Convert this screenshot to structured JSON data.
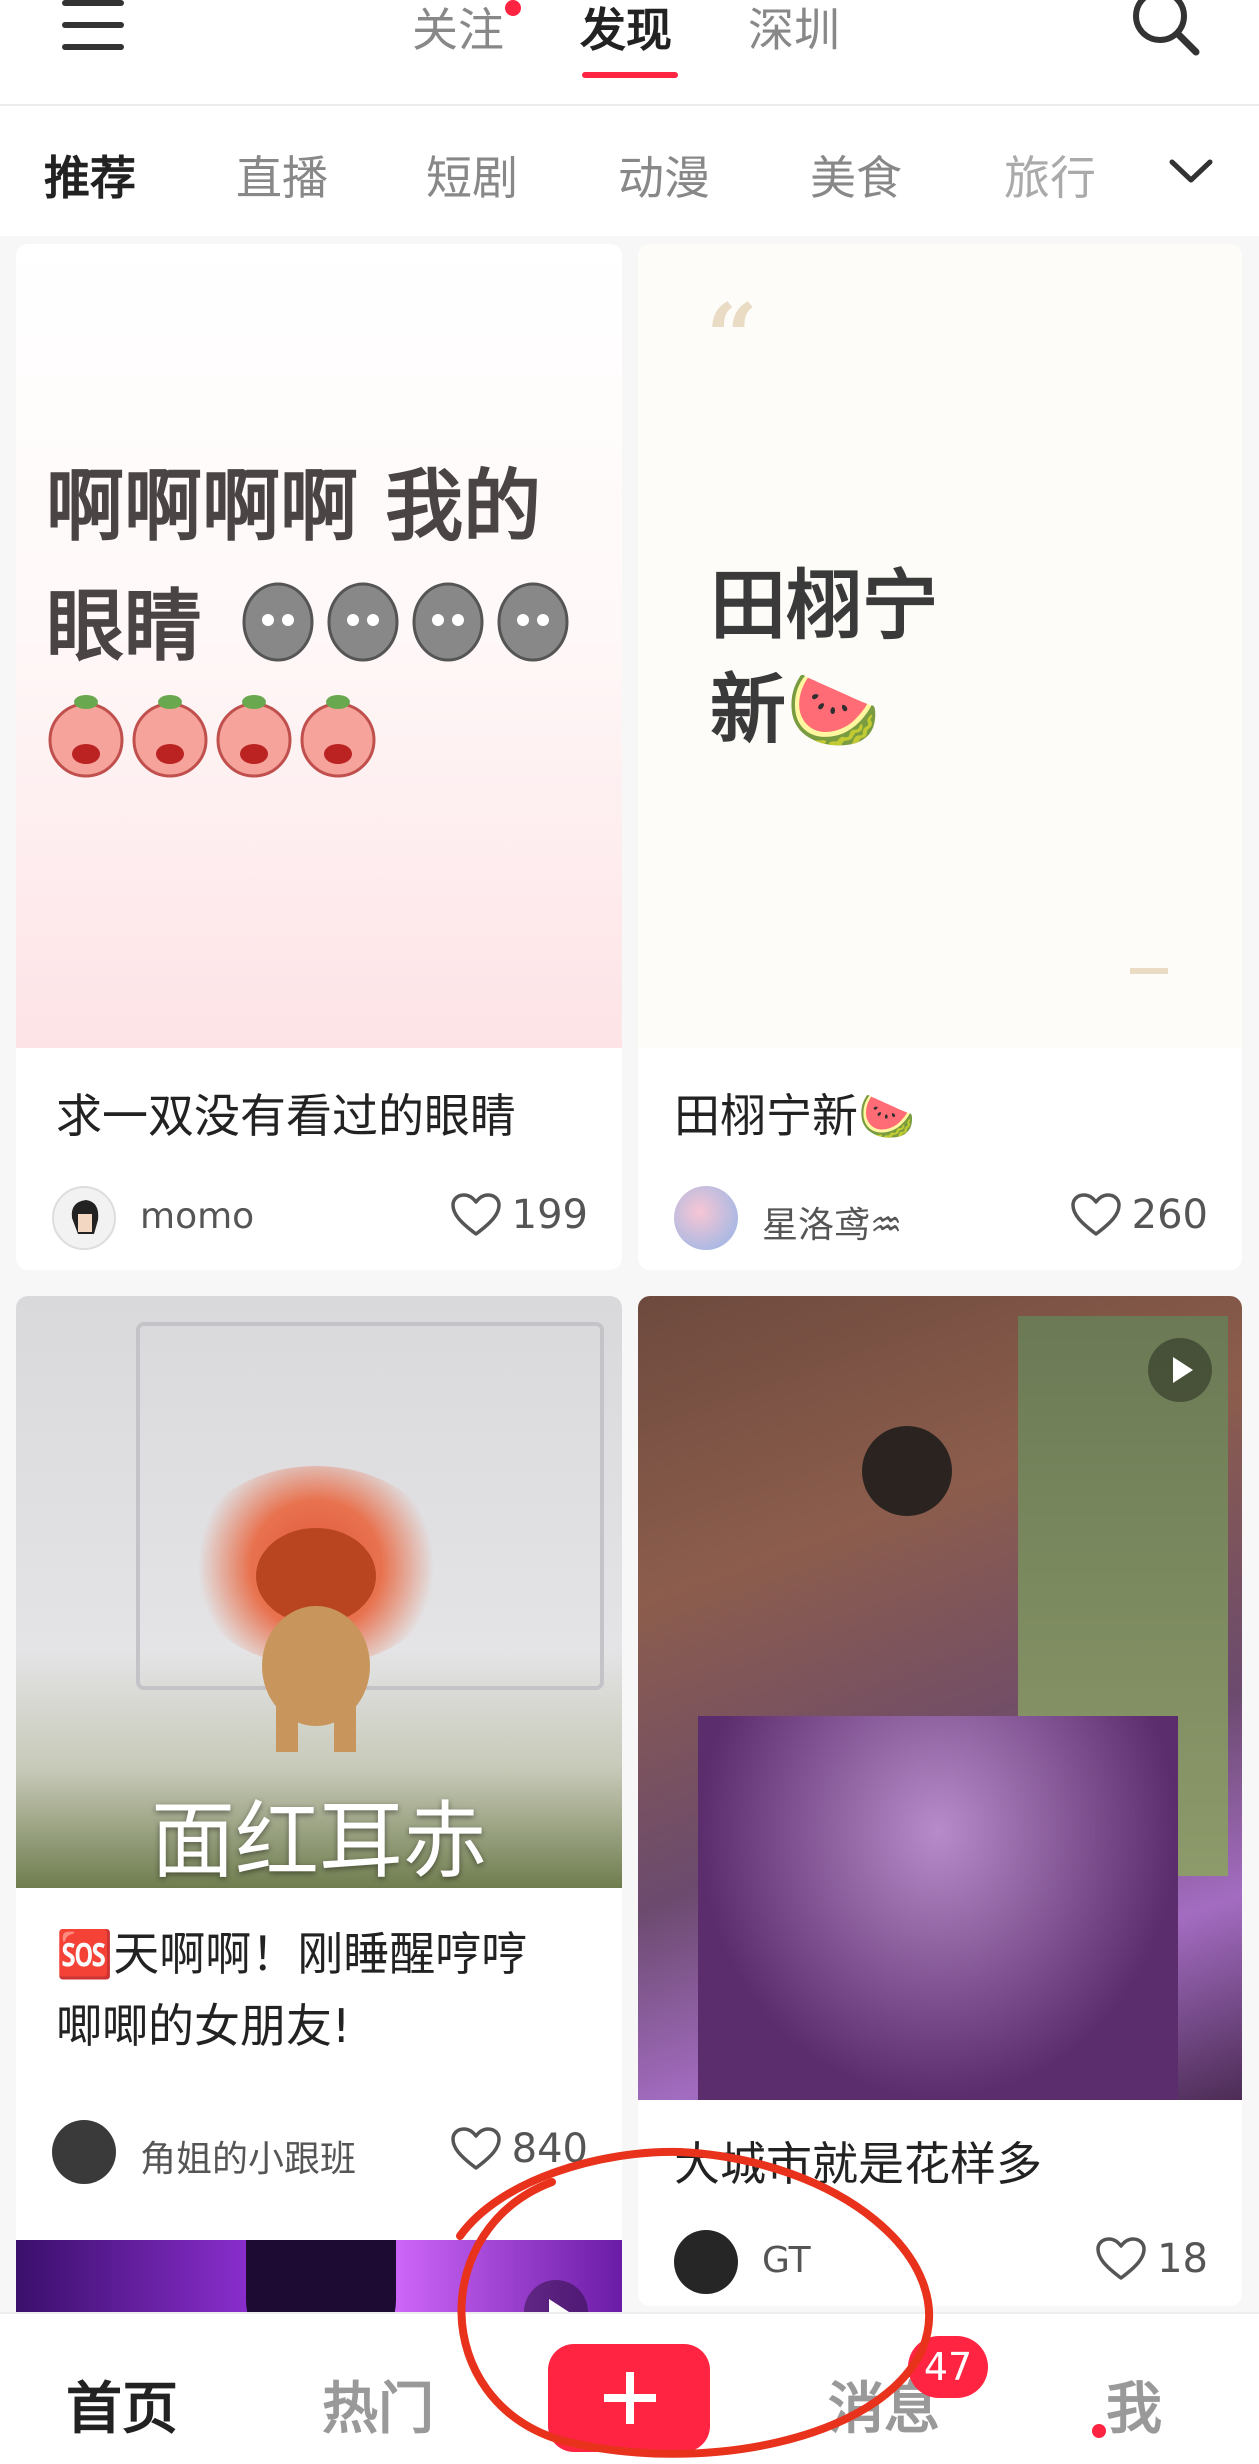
{
  "header": {
    "tabs": [
      {
        "label": "关注"
      },
      {
        "label": "发现"
      },
      {
        "label": "深圳"
      }
    ]
  },
  "categories": [
    "推荐",
    "直播",
    "短剧",
    "动漫",
    "美食",
    "旅行"
  ],
  "feed": {
    "cards": [
      {
        "cover_text_line1": "啊啊啊啊 我的",
        "cover_text_line2": "眼睛",
        "title": "求一双没有看过的眼睛",
        "author": "momo",
        "likes": "199"
      },
      {
        "cover_text_line1": "田栩宁",
        "cover_text_line2": "新🍉",
        "title": "田栩宁新🍉",
        "author": "星洛鸢♒",
        "likes": "260"
      },
      {
        "cover_caption": "面红耳赤",
        "title_line1": "🆘天啊啊！刚睡醒哼哼",
        "title_line2": "唧唧的女朋友!",
        "author": "角姐的小跟班",
        "likes": "840"
      },
      {
        "title": "大城市就是花样多",
        "author": "GT",
        "likes": "18"
      }
    ]
  },
  "bottom_nav": {
    "home": "首页",
    "hot": "热门",
    "messages": "消息",
    "messages_badge": "47",
    "me": "我"
  },
  "colors": {
    "accent": "#ff2442",
    "annotation": "#e8321c"
  }
}
